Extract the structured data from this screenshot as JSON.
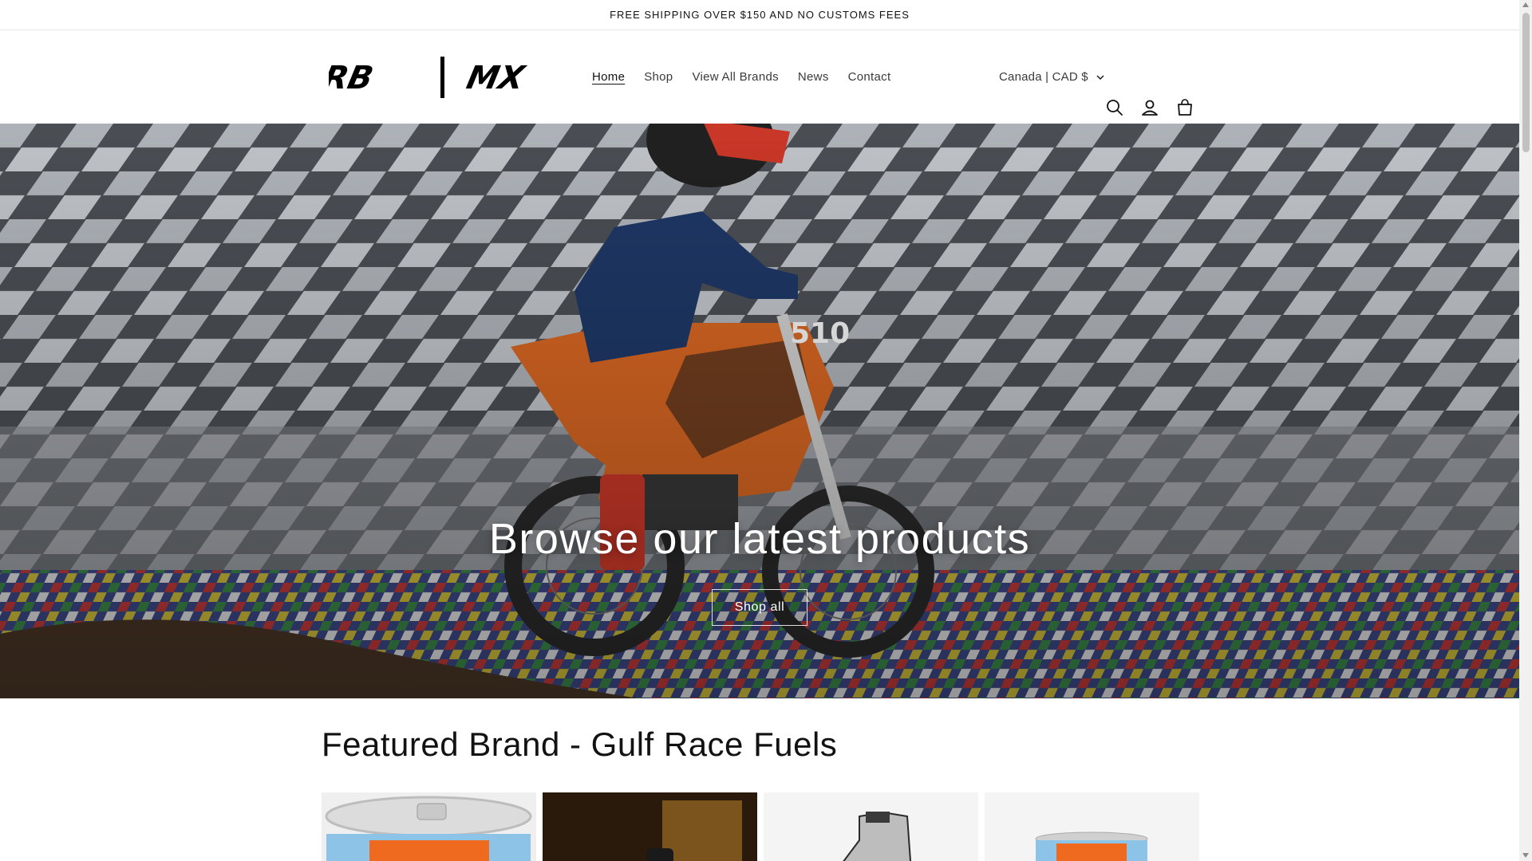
{
  "announcement": {
    "text": "FREE SHIPPING OVER $150 AND NO CUSTOMS FEES"
  },
  "header": {
    "logo_text": "RB | MX",
    "nav": [
      {
        "label": "Home",
        "active": true
      },
      {
        "label": "Shop",
        "active": false
      },
      {
        "label": "View All Brands",
        "active": false
      },
      {
        "label": "News",
        "active": false
      },
      {
        "label": "Contact",
        "active": false
      }
    ],
    "country_selector": "Canada | CAD $",
    "icons": [
      "search-icon",
      "account-icon",
      "cart-icon"
    ]
  },
  "hero": {
    "title": "Browse our latest products",
    "button_label": "Shop all",
    "image_alt_subject": "young rider on orange dirt bike jumping in stadium",
    "bike_number": "510"
  },
  "featured": {
    "title": "Featured Brand - Gulf Race Fuels",
    "products": [
      {
        "image": "fuel-can-orange-blue"
      },
      {
        "image": "bottle-dark-background"
      },
      {
        "image": "jug-silver"
      },
      {
        "image": "drum-orange-blue"
      }
    ]
  },
  "colors": {
    "gulf_blue": "#8cc3e6",
    "gulf_orange": "#ef6a1f",
    "text": "#121212"
  }
}
